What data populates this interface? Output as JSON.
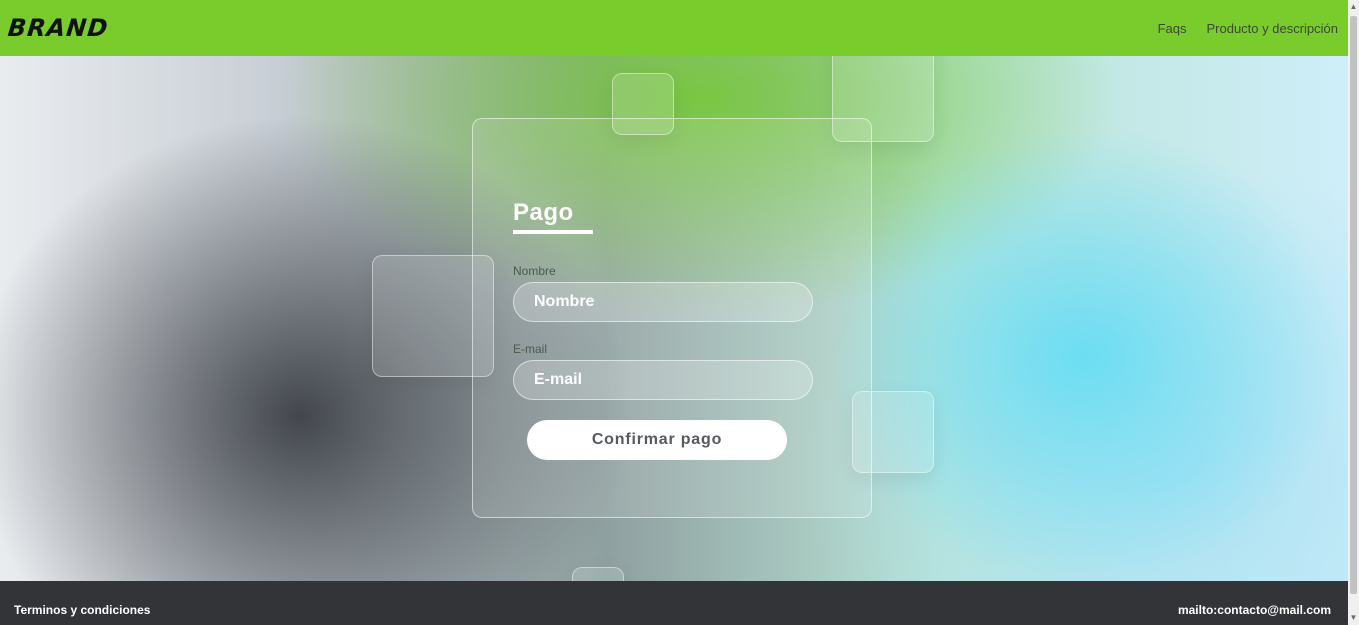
{
  "navbar": {
    "brand": "BRAND",
    "links": [
      {
        "label": "Faqs"
      },
      {
        "label": "Producto y descripción"
      }
    ]
  },
  "form": {
    "title": "Pago",
    "fields": [
      {
        "label": "Nombre",
        "placeholder": "Nombre"
      },
      {
        "label": "E-mail",
        "placeholder": "E-mail"
      }
    ],
    "submit_label": "Confirmar pago"
  },
  "footer": {
    "terms_label": "Terminos y condiciones",
    "contact_label": "mailto:contacto@mail.com"
  },
  "colors": {
    "navbar": "#79cc2c",
    "footer": "#333438",
    "button": "#ffffff"
  },
  "icons": {
    "scroll_up": "arrow-up-icon",
    "scroll_down": "arrow-down-icon"
  }
}
